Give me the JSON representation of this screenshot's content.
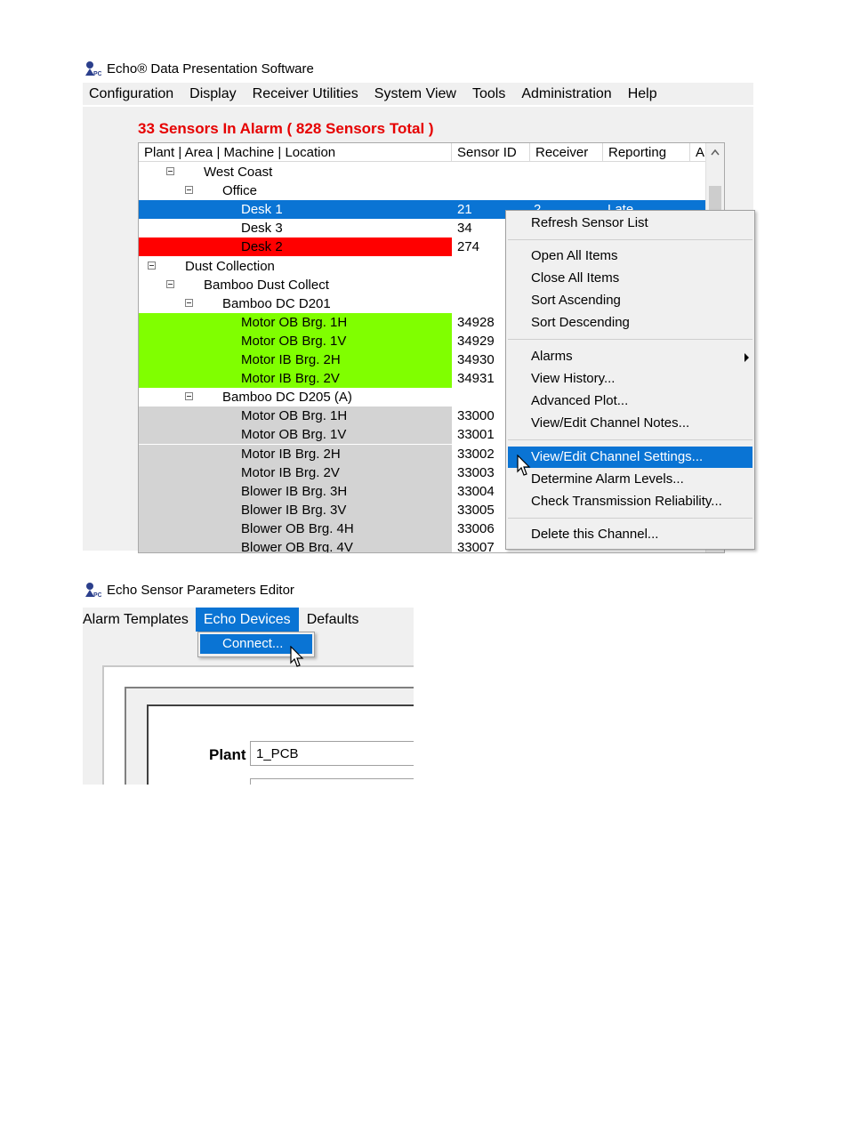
{
  "window1": {
    "title": "Echo® Data Presentation Software",
    "menu": [
      "Configuration",
      "Display",
      "Receiver Utilities",
      "System View",
      "Tools",
      "Administration",
      "Help"
    ],
    "alarm_header": "33 Sensors In Alarm ( 828 Sensors Total )",
    "columns": [
      "Plant | Area | Machine | Location",
      "Sensor ID",
      "Receiver",
      "Reporting",
      "A"
    ],
    "rows": [
      {
        "name": "West Coast",
        "id": "",
        "rx": "",
        "rep": ""
      },
      {
        "name": "Office",
        "id": "",
        "rx": "",
        "rep": ""
      },
      {
        "name": "Desk 1",
        "id": "21",
        "rx": "2",
        "rep": "Late"
      },
      {
        "name": "Desk 3",
        "id": "34",
        "rx": "",
        "rep": ""
      },
      {
        "name": "Desk 2",
        "id": "274",
        "rx": "",
        "rep": ""
      },
      {
        "name": "Dust Collection",
        "id": "",
        "rx": "",
        "rep": ""
      },
      {
        "name": "Bamboo Dust Collect",
        "id": "",
        "rx": "",
        "rep": ""
      },
      {
        "name": "Bamboo DC D201",
        "id": "",
        "rx": "",
        "rep": ""
      },
      {
        "name": "Motor OB Brg. 1H",
        "id": "34928",
        "rx": "",
        "rep": ""
      },
      {
        "name": "Motor OB Brg. 1V",
        "id": "34929",
        "rx": "",
        "rep": ""
      },
      {
        "name": "Motor IB Brg. 2H",
        "id": "34930",
        "rx": "",
        "rep": ""
      },
      {
        "name": "Motor IB Brg. 2V",
        "id": "34931",
        "rx": "",
        "rep": ""
      },
      {
        "name": "Bamboo DC D205 (A)",
        "id": "",
        "rx": "",
        "rep": ""
      },
      {
        "name": "Motor OB Brg. 1H",
        "id": "33000",
        "rx": "",
        "rep": ""
      },
      {
        "name": "Motor OB Brg. 1V",
        "id": "33001",
        "rx": "",
        "rep": ""
      },
      {
        "name": "Motor IB Brg. 2H",
        "id": "33002",
        "rx": "",
        "rep": ""
      },
      {
        "name": "Motor IB Brg. 2V",
        "id": "33003",
        "rx": "",
        "rep": ""
      },
      {
        "name": "Blower IB Brg. 3H",
        "id": "33004",
        "rx": "",
        "rep": ""
      },
      {
        "name": "Blower IB Brg. 3V",
        "id": "33005",
        "rx": "",
        "rep": ""
      },
      {
        "name": "Blower OB Brg. 4H",
        "id": "33006",
        "rx": "",
        "rep": ""
      },
      {
        "name": "Blower OB Brg. 4V",
        "id": "33007",
        "rx": "",
        "rep": ""
      }
    ],
    "context_menu": {
      "items": [
        "Refresh Sensor List",
        "Open All Items",
        "Close All Items",
        "Sort Ascending",
        "Sort Descending",
        "Alarms",
        "View History...",
        "Advanced Plot...",
        "View/Edit Channel Notes...",
        "View/Edit Channel Settings...",
        "Determine Alarm Levels...",
        "Check Transmission Reliability...",
        "Delete this Channel..."
      ]
    },
    "colors": {
      "selected": "#0a74d4",
      "alarm_red": "#ff0000",
      "green": "#80ff00",
      "gray": "#d3d3d3"
    }
  },
  "window2": {
    "title": "Echo Sensor Parameters Editor",
    "menu": [
      "Alarm Templates",
      "Echo Devices",
      "Defaults"
    ],
    "dropdown_item": "Connect...",
    "plant_label": "Plant",
    "plant_value": "1_PCB"
  }
}
